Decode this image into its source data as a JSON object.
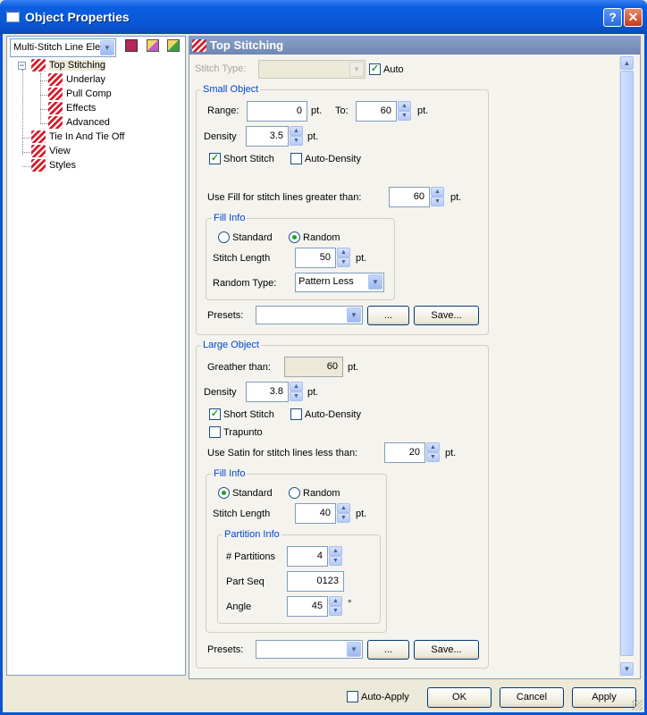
{
  "window": {
    "title": "Object Properties"
  },
  "left": {
    "combo_value": "Multi-Stitch Line Elem",
    "tree": [
      "Top Stitching",
      "Underlay",
      "Pull Comp",
      "Effects",
      "Advanced",
      "Tie In And Tie Off",
      "View",
      "Styles"
    ]
  },
  "header": {
    "title": "Top Stitching"
  },
  "stitch_type": {
    "label": "Stitch Type:",
    "value": "",
    "auto_label": "Auto",
    "auto_checked": true
  },
  "small": {
    "legend": "Small Object",
    "range_label": "Range:",
    "range_value": "0",
    "pt1": "pt.",
    "to_label": "To:",
    "to_value": "60",
    "pt2": "pt.",
    "density_label": "Density",
    "density_value": "3.5",
    "pt3": "pt.",
    "short_stitch_label": "Short Stitch",
    "auto_density_label": "Auto-Density",
    "use_fill_label": "Use Fill for stitch lines greater than:",
    "use_fill_value": "60",
    "pt4": "pt.",
    "fill_info": {
      "legend": "Fill Info",
      "standard_label": "Standard",
      "random_label": "Random",
      "stitch_length_label": "Stitch Length",
      "stitch_length_value": "50",
      "pt": "pt.",
      "random_type_label": "Random Type:",
      "random_type_value": "Pattern Less"
    },
    "presets_label": "Presets:",
    "dots_label": "...",
    "save_label": "Save..."
  },
  "large": {
    "legend": "Large Object",
    "greater_label": "Greather than:",
    "greater_value": "60",
    "pt1": "pt.",
    "density_label": "Density",
    "density_value": "3.8",
    "pt2": "pt.",
    "short_stitch_label": "Short Stitch",
    "auto_density_label": "Auto-Density",
    "trapunto_label": "Trapunto",
    "use_satin_label": "Use Satin for stitch lines less than:",
    "use_satin_value": "20",
    "pt3": "pt.",
    "fill_info": {
      "legend": "Fill Info",
      "standard_label": "Standard",
      "random_label": "Random",
      "stitch_length_label": "Stitch Length",
      "stitch_length_value": "40",
      "pt": "pt.",
      "partition": {
        "legend": "Partition Info",
        "partitions_label": "# Partitions",
        "partitions_value": "4",
        "part_seq_label": "Part Seq",
        "part_seq_value": "0123",
        "angle_label": "Angle",
        "angle_value": "45",
        "degree": "°"
      }
    },
    "presets_label": "Presets:",
    "dots_label": "...",
    "save_label": "Save..."
  },
  "footer": {
    "auto_apply_label": "Auto-Apply",
    "ok_label": "OK",
    "cancel_label": "Cancel",
    "apply_label": "Apply"
  }
}
